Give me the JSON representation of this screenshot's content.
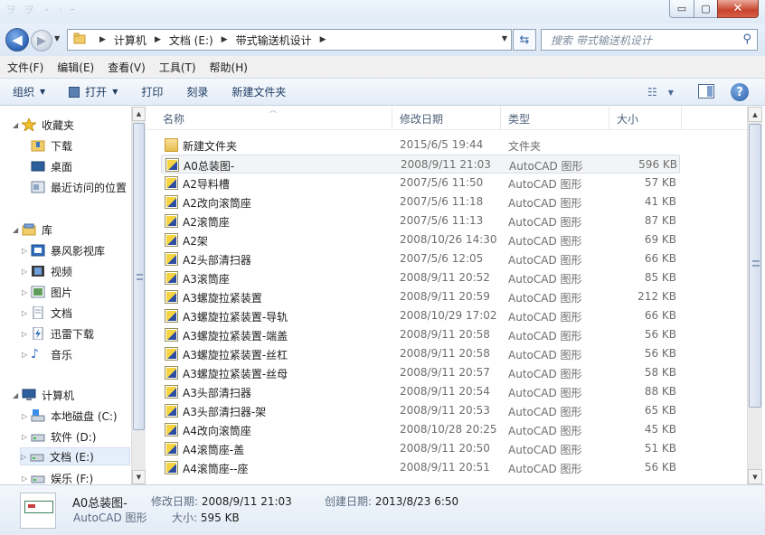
{
  "titlebar": {
    "faint_title": "ヲ ヲ ・ · ｰ",
    "min": "▭",
    "max": "▢",
    "close": "✕"
  },
  "nav": {
    "back_glyph": "◀",
    "forward_glyph": "▶",
    "breadcrumbs": [
      "计算机",
      "文档 (E:)",
      "带式输送机设计"
    ],
    "search_placeholder": "搜索 带式输送机设计"
  },
  "menu": [
    "文件(F)",
    "编辑(E)",
    "查看(V)",
    "工具(T)",
    "帮助(H)"
  ],
  "toolbar": {
    "organize": "组织",
    "open": "打开",
    "print": "打印",
    "burn": "刻录",
    "new_folder": "新建文件夹",
    "view_glyph": "☷"
  },
  "navpane": {
    "favorites": {
      "label": "收藏夹",
      "items": [
        "下载",
        "桌面",
        "最近访问的位置"
      ]
    },
    "libraries": {
      "label": "库",
      "items": [
        "暴风影视库",
        "视频",
        "图片",
        "文档",
        "迅雷下载",
        "音乐"
      ]
    },
    "computer": {
      "label": "计算机",
      "items": [
        "本地磁盘 (C:)",
        "软件 (D:)",
        "文档 (E:)",
        "娱乐 (F:)"
      ]
    }
  },
  "columns": {
    "name": "名称",
    "date": "修改日期",
    "type": "类型",
    "size": "大小"
  },
  "files": [
    {
      "name": "新建文件夹",
      "date": "2015/6/5 19:44",
      "type": "文件夹",
      "size": "",
      "icon": "folder-icon"
    },
    {
      "name": "A0总装图-",
      "date": "2008/9/11 21:03",
      "type": "AutoCAD 图形",
      "size": "596 KB",
      "icon": "autocad-file-icon"
    },
    {
      "name": "A2导料槽",
      "date": "2007/5/6 11:50",
      "type": "AutoCAD 图形",
      "size": "57 KB",
      "icon": "autocad-file-icon"
    },
    {
      "name": "A2改向滚筒座",
      "date": "2007/5/6 11:18",
      "type": "AutoCAD 图形",
      "size": "41 KB",
      "icon": "autocad-file-icon"
    },
    {
      "name": "A2滚筒座",
      "date": "2007/5/6 11:13",
      "type": "AutoCAD 图形",
      "size": "87 KB",
      "icon": "autocad-file-icon"
    },
    {
      "name": "A2架",
      "date": "2008/10/26 14:30",
      "type": "AutoCAD 图形",
      "size": "69 KB",
      "icon": "autocad-file-icon"
    },
    {
      "name": "A2头部清扫器",
      "date": "2007/5/6 12:05",
      "type": "AutoCAD 图形",
      "size": "66 KB",
      "icon": "autocad-file-icon"
    },
    {
      "name": "A3滚筒座",
      "date": "2008/9/11 20:52",
      "type": "AutoCAD 图形",
      "size": "85 KB",
      "icon": "autocad-file-icon"
    },
    {
      "name": "A3螺旋拉紧装置",
      "date": "2008/9/11 20:59",
      "type": "AutoCAD 图形",
      "size": "212 KB",
      "icon": "autocad-file-icon"
    },
    {
      "name": "A3螺旋拉紧装置-导轨",
      "date": "2008/10/29 17:02",
      "type": "AutoCAD 图形",
      "size": "66 KB",
      "icon": "autocad-file-icon"
    },
    {
      "name": "A3螺旋拉紧装置-端盖",
      "date": "2008/9/11 20:58",
      "type": "AutoCAD 图形",
      "size": "56 KB",
      "icon": "autocad-file-icon"
    },
    {
      "name": "A3螺旋拉紧装置-丝杠",
      "date": "2008/9/11 20:58",
      "type": "AutoCAD 图形",
      "size": "56 KB",
      "icon": "autocad-file-icon"
    },
    {
      "name": "A3螺旋拉紧装置-丝母",
      "date": "2008/9/11 20:57",
      "type": "AutoCAD 图形",
      "size": "58 KB",
      "icon": "autocad-file-icon"
    },
    {
      "name": "A3头部清扫器",
      "date": "2008/9/11 20:54",
      "type": "AutoCAD 图形",
      "size": "88 KB",
      "icon": "autocad-file-icon"
    },
    {
      "name": "A3头部清扫器-架",
      "date": "2008/9/11 20:53",
      "type": "AutoCAD 图形",
      "size": "65 KB",
      "icon": "autocad-file-icon"
    },
    {
      "name": "A4改向滚筒座",
      "date": "2008/10/28 20:25",
      "type": "AutoCAD 图形",
      "size": "45 KB",
      "icon": "autocad-file-icon"
    },
    {
      "name": "A4滚筒座-盖",
      "date": "2008/9/11 20:50",
      "type": "AutoCAD 图形",
      "size": "51 KB",
      "icon": "autocad-file-icon"
    },
    {
      "name": "A4滚筒座--座",
      "date": "2008/9/11 20:51",
      "type": "AutoCAD 图形",
      "size": "56 KB",
      "icon": "autocad-file-icon"
    }
  ],
  "details": {
    "name": "A0总装图-",
    "type": "AutoCAD 图形",
    "modified_label": "修改日期:",
    "modified_value": "2008/9/11 21:03",
    "created_label": "创建日期:",
    "created_value": "2013/8/23 6:50",
    "size_label": "大小:",
    "size_value": "595 KB"
  }
}
